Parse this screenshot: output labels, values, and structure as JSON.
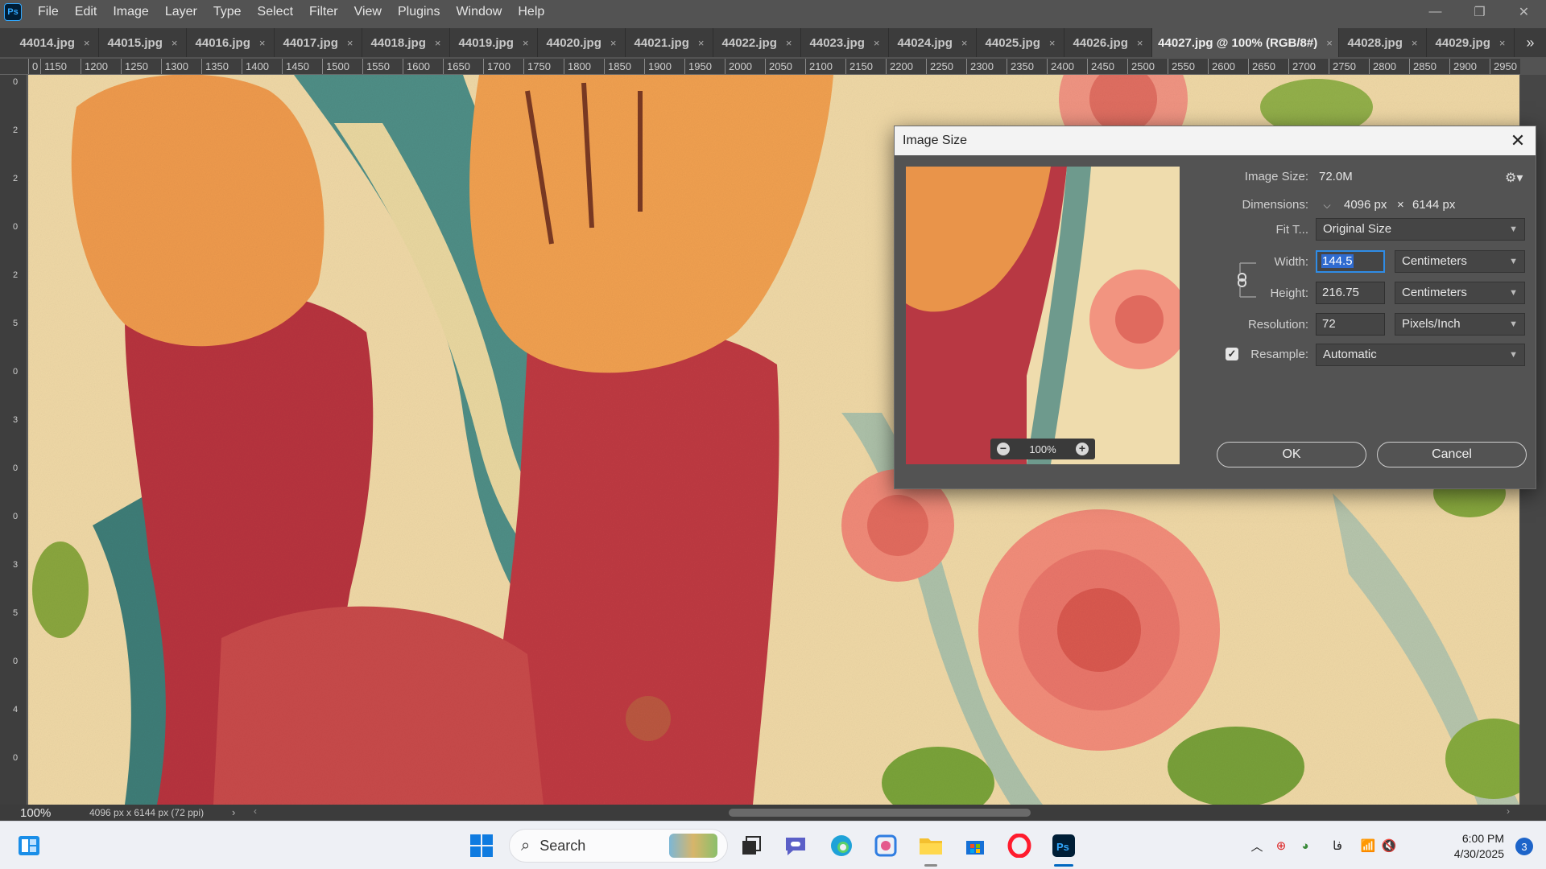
{
  "menubar": {
    "app_icon": "ps-logo",
    "app_abbr": "Ps",
    "items": [
      "File",
      "Edit",
      "Image",
      "Layer",
      "Type",
      "Select",
      "Filter",
      "View",
      "Plugins",
      "Window",
      "Help"
    ]
  },
  "tabs": [
    {
      "label": "44014.jpg"
    },
    {
      "label": "44015.jpg"
    },
    {
      "label": "44016.jpg"
    },
    {
      "label": "44017.jpg"
    },
    {
      "label": "44018.jpg"
    },
    {
      "label": "44019.jpg"
    },
    {
      "label": "44020.jpg"
    },
    {
      "label": "44021.jpg"
    },
    {
      "label": "44022.jpg"
    },
    {
      "label": "44023.jpg"
    },
    {
      "label": "44024.jpg"
    },
    {
      "label": "44025.jpg"
    },
    {
      "label": "44026.jpg"
    },
    {
      "label": "44027.jpg @ 100% (RGB/8#)",
      "active": true
    },
    {
      "label": "44028.jpg"
    },
    {
      "label": "44029.jpg"
    }
  ],
  "tab_close_glyph": "×",
  "tab_overflow_glyph": "»",
  "ruler": {
    "h_labels": [
      "0",
      "1150",
      "1200",
      "1250",
      "1300",
      "1350",
      "1400",
      "1450",
      "1500",
      "1550",
      "1600",
      "1650",
      "1700",
      "1750",
      "1800",
      "1850",
      "1900",
      "1950",
      "2000",
      "2050",
      "2100",
      "2150",
      "2200",
      "2250",
      "2300",
      "2350",
      "2400",
      "2450",
      "2500",
      "2550",
      "2600",
      "2650",
      "2700",
      "2750",
      "2800",
      "2850",
      "2900",
      "2950"
    ],
    "v_labels": [
      "0",
      "2",
      "2",
      "0",
      "2",
      "5",
      "0",
      "3",
      "0",
      "0",
      "3",
      "5",
      "0",
      "4",
      "0"
    ]
  },
  "status": {
    "zoom": "100%",
    "doc_info": "4096 px x 6144 px (72 ppi)"
  },
  "dialog": {
    "title": "Image Size",
    "preview_zoom": "100%",
    "image_size_label": "Image Size:",
    "image_size_value": "72.0M",
    "dimensions_label": "Dimensions:",
    "dim_width": "4096 px",
    "dim_times": "×",
    "dim_height": "6144 px",
    "fit_label": "Fit T...",
    "fit_value": "Original Size",
    "width_label": "Width:",
    "width_value": "144.5",
    "width_unit": "Centimeters",
    "height_label": "Height:",
    "height_value": "216.75",
    "height_unit": "Centimeters",
    "resolution_label": "Resolution:",
    "resolution_value": "72",
    "resolution_unit": "Pixels/Inch",
    "resample_label": "Resample:",
    "resample_checked": true,
    "resample_value": "Automatic",
    "ok_label": "OK",
    "cancel_label": "Cancel"
  },
  "taskbar": {
    "search_placeholder": "Search",
    "clock_time": "6:00 PM",
    "clock_date": "4/30/2025",
    "notification_count": "3",
    "tray_lang": "فا"
  },
  "colors": {
    "ps_blue": "#31a8ff",
    "accent": "#0067c0",
    "selection": "#2f6bd0"
  }
}
